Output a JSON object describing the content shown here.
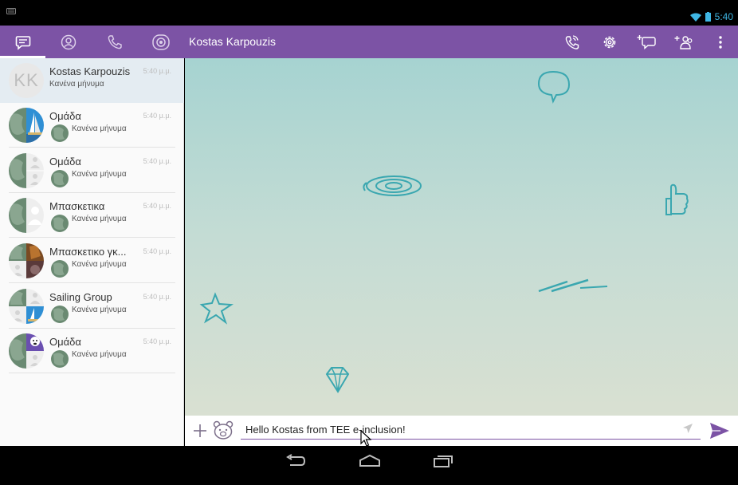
{
  "status_bar": {
    "time": "5:40"
  },
  "toolbar": {
    "title": "Kostas Karpouzis",
    "tabs": [
      {
        "name": "chats",
        "icon": "chat-bubble-icon",
        "active": true
      },
      {
        "name": "contacts",
        "icon": "contacts-icon",
        "active": false
      },
      {
        "name": "calls",
        "icon": "phone-icon",
        "active": false
      },
      {
        "name": "public",
        "icon": "public-chats-icon",
        "active": false
      }
    ],
    "actions": [
      "call-icon",
      "settings-icon",
      "new-chat-icon",
      "add-participant-icon",
      "overflow-menu-icon"
    ]
  },
  "conversations": [
    {
      "name": "Kostas Karpouzis",
      "initials": "KK",
      "time": "5:40 μ.μ.",
      "subtitle": "Κανένα μήνυμα",
      "active": true,
      "group": false
    },
    {
      "name": "Ομάδα",
      "time": "5:40 μ.μ.",
      "subtitle": "Κανένα μήνυμα",
      "active": false,
      "group": true
    },
    {
      "name": "Ομάδα",
      "time": "5:40 μ.μ.",
      "subtitle": "Κανένα μήνυμα",
      "active": false,
      "group": true
    },
    {
      "name": "Μπασκετικα",
      "time": "5:40 μ.μ.",
      "subtitle": "Κανένα μήνυμα",
      "active": false,
      "group": true
    },
    {
      "name": "Μπασκετικο γκ...",
      "time": "5:40 μ.μ.",
      "subtitle": "Κανένα μήνυμα",
      "active": false,
      "group": true
    },
    {
      "name": "Sailing Group",
      "time": "5:40 μ.μ.",
      "subtitle": "Κανένα μήνυμα",
      "active": false,
      "group": true
    },
    {
      "name": "Ομάδα",
      "time": "5:40 μ.μ.",
      "subtitle": "Κανένα μήνυμα",
      "active": false,
      "group": true
    }
  ],
  "composer": {
    "value": "Hello Kostas from TEE e-inclusion!"
  },
  "colors": {
    "accent": "#7c53a5",
    "status_blue": "#3fb6e4"
  }
}
